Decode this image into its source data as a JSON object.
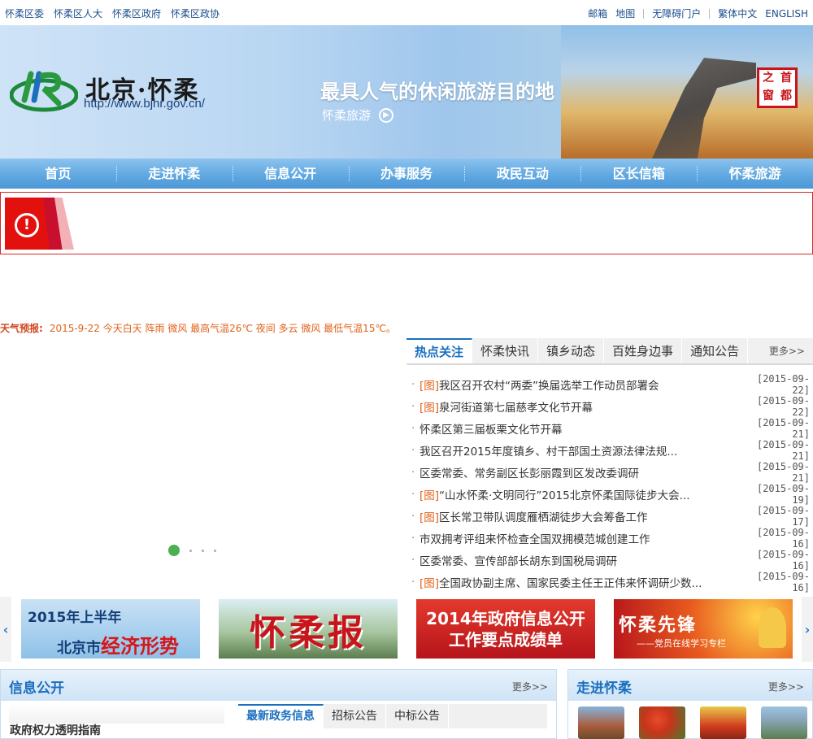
{
  "topbar": {
    "left_links": [
      "怀柔区委",
      "怀柔区人大",
      "怀柔区政府",
      "怀柔区政协"
    ],
    "right_links": [
      "邮箱",
      "地图",
      "无障碍门户",
      "繁体中文",
      "ENGLISH"
    ]
  },
  "banner": {
    "logo_text": "北京·怀柔",
    "url": "http://www.bjhr.gov.cn/",
    "slogan": "最具人气的休闲旅游目的地",
    "tour_link": "怀柔旅游",
    "seal_chars": [
      "首",
      "都",
      "之",
      "窗"
    ]
  },
  "nav": [
    "首页",
    "走进怀柔",
    "信息公开",
    "办事服务",
    "政民互动",
    "区长信箱",
    "怀柔旅游"
  ],
  "weather": {
    "label": "天气预报:",
    "text": "2015-9-22 今天白天 阵雨 微风 最高气温26℃ 夜间 多云 微风 最低气温15℃。"
  },
  "news": {
    "tabs": [
      "热点关注",
      "怀柔快讯",
      "镇乡动态",
      "百姓身边事",
      "通知公告"
    ],
    "more": "更多>>",
    "items": [
      {
        "tag": "[图]",
        "title": "我区召开农村“两委”换届选举工作动员部署会",
        "date": "[2015-09-22]"
      },
      {
        "tag": "[图]",
        "title": "泉河街道第七届慈孝文化节开幕",
        "date": "[2015-09-22]"
      },
      {
        "tag": "",
        "title": "怀柔区第三届板栗文化节开幕",
        "date": "[2015-09-21]"
      },
      {
        "tag": "",
        "title": "我区召开2015年度镇乡、村干部国土资源法律法规...",
        "date": "[2015-09-21]"
      },
      {
        "tag": "",
        "title": "区委常委、常务副区长彭丽霞到区发改委调研",
        "date": "[2015-09-21]"
      },
      {
        "tag": "[图]",
        "title": "“山水怀柔·文明同行”2015北京怀柔国际徒步大会...",
        "date": "[2015-09-19]"
      },
      {
        "tag": "[图]",
        "title": "区长常卫带队调度雁栖湖徒步大会筹备工作",
        "date": "[2015-09-17]"
      },
      {
        "tag": "",
        "title": "市双拥考评组来怀检查全国双拥模范城创建工作",
        "date": "[2015-09-16]"
      },
      {
        "tag": "",
        "title": "区委常委、宣传部部长胡东到国税局调研",
        "date": "[2015-09-16]"
      },
      {
        "tag": "[图]",
        "title": "全国政协副主席、国家民委主任王正伟来怀调研少数...",
        "date": "[2015-09-16]"
      }
    ]
  },
  "promo": {
    "prev": "‹",
    "next": "›",
    "card1_line1": "2015年上半年",
    "card1_line2_a": "北京市",
    "card1_line2_b": "经济形势",
    "card2": "怀柔报",
    "card3_line1": "2014年政府信息公开",
    "card3_line2": "工作要点成绩单",
    "card4_title": "怀柔先锋",
    "card4_sub": "——党员在线学习专栏"
  },
  "info": {
    "title": "信息公开",
    "more": "更多>>",
    "guide": "政府权力透明指南",
    "tabs": [
      "最新政务信息",
      "招标公告",
      "中标公告"
    ]
  },
  "intro": {
    "title": "走进怀柔",
    "more": "更多>>"
  }
}
